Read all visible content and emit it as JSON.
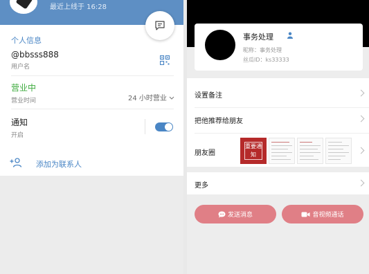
{
  "left": {
    "last_online": "最近上线于 16:28",
    "section_title": "个人信息",
    "username": {
      "value": "@bbsss888",
      "label": "用户名"
    },
    "business": {
      "status": "营业中",
      "label": "营业时间",
      "hours": "24 小时营业"
    },
    "notify": {
      "label": "通知",
      "value": "开启"
    },
    "add_contact": "添加为联系人"
  },
  "right": {
    "profile": {
      "name": "事务处理",
      "nickname": "昵称：事务处理",
      "id": "丝瓜ID：ks33333"
    },
    "rows": {
      "remark": "设置备注",
      "recommend": "把他推荐给朋友",
      "moments": "朋友圈",
      "more": "更多"
    },
    "moments_stamp": "重要通知",
    "buttons": {
      "message": "发送消息",
      "call": "音视频通话"
    }
  },
  "colors": {
    "accent": "#4a86c5",
    "header": "#5e8fc4",
    "button": "#e07f86"
  }
}
